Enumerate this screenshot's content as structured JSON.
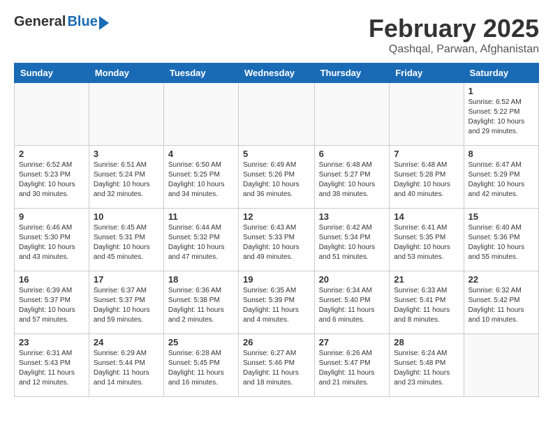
{
  "header": {
    "logo_general": "General",
    "logo_blue": "Blue",
    "month": "February 2025",
    "location": "Qashqal, Parwan, Afghanistan"
  },
  "weekdays": [
    "Sunday",
    "Monday",
    "Tuesday",
    "Wednesday",
    "Thursday",
    "Friday",
    "Saturday"
  ],
  "weeks": [
    [
      {
        "day": "",
        "info": ""
      },
      {
        "day": "",
        "info": ""
      },
      {
        "day": "",
        "info": ""
      },
      {
        "day": "",
        "info": ""
      },
      {
        "day": "",
        "info": ""
      },
      {
        "day": "",
        "info": ""
      },
      {
        "day": "1",
        "info": "Sunrise: 6:52 AM\nSunset: 5:22 PM\nDaylight: 10 hours and 29 minutes."
      }
    ],
    [
      {
        "day": "2",
        "info": "Sunrise: 6:52 AM\nSunset: 5:23 PM\nDaylight: 10 hours and 30 minutes."
      },
      {
        "day": "3",
        "info": "Sunrise: 6:51 AM\nSunset: 5:24 PM\nDaylight: 10 hours and 32 minutes."
      },
      {
        "day": "4",
        "info": "Sunrise: 6:50 AM\nSunset: 5:25 PM\nDaylight: 10 hours and 34 minutes."
      },
      {
        "day": "5",
        "info": "Sunrise: 6:49 AM\nSunset: 5:26 PM\nDaylight: 10 hours and 36 minutes."
      },
      {
        "day": "6",
        "info": "Sunrise: 6:48 AM\nSunset: 5:27 PM\nDaylight: 10 hours and 38 minutes."
      },
      {
        "day": "7",
        "info": "Sunrise: 6:48 AM\nSunset: 5:28 PM\nDaylight: 10 hours and 40 minutes."
      },
      {
        "day": "8",
        "info": "Sunrise: 6:47 AM\nSunset: 5:29 PM\nDaylight: 10 hours and 42 minutes."
      }
    ],
    [
      {
        "day": "9",
        "info": "Sunrise: 6:46 AM\nSunset: 5:30 PM\nDaylight: 10 hours and 43 minutes."
      },
      {
        "day": "10",
        "info": "Sunrise: 6:45 AM\nSunset: 5:31 PM\nDaylight: 10 hours and 45 minutes."
      },
      {
        "day": "11",
        "info": "Sunrise: 6:44 AM\nSunset: 5:32 PM\nDaylight: 10 hours and 47 minutes."
      },
      {
        "day": "12",
        "info": "Sunrise: 6:43 AM\nSunset: 5:33 PM\nDaylight: 10 hours and 49 minutes."
      },
      {
        "day": "13",
        "info": "Sunrise: 6:42 AM\nSunset: 5:34 PM\nDaylight: 10 hours and 51 minutes."
      },
      {
        "day": "14",
        "info": "Sunrise: 6:41 AM\nSunset: 5:35 PM\nDaylight: 10 hours and 53 minutes."
      },
      {
        "day": "15",
        "info": "Sunrise: 6:40 AM\nSunset: 5:36 PM\nDaylight: 10 hours and 55 minutes."
      }
    ],
    [
      {
        "day": "16",
        "info": "Sunrise: 6:39 AM\nSunset: 5:37 PM\nDaylight: 10 hours and 57 minutes."
      },
      {
        "day": "17",
        "info": "Sunrise: 6:37 AM\nSunset: 5:37 PM\nDaylight: 10 hours and 59 minutes."
      },
      {
        "day": "18",
        "info": "Sunrise: 6:36 AM\nSunset: 5:38 PM\nDaylight: 11 hours and 2 minutes."
      },
      {
        "day": "19",
        "info": "Sunrise: 6:35 AM\nSunset: 5:39 PM\nDaylight: 11 hours and 4 minutes."
      },
      {
        "day": "20",
        "info": "Sunrise: 6:34 AM\nSunset: 5:40 PM\nDaylight: 11 hours and 6 minutes."
      },
      {
        "day": "21",
        "info": "Sunrise: 6:33 AM\nSunset: 5:41 PM\nDaylight: 11 hours and 8 minutes."
      },
      {
        "day": "22",
        "info": "Sunrise: 6:32 AM\nSunset: 5:42 PM\nDaylight: 11 hours and 10 minutes."
      }
    ],
    [
      {
        "day": "23",
        "info": "Sunrise: 6:31 AM\nSunset: 5:43 PM\nDaylight: 11 hours and 12 minutes."
      },
      {
        "day": "24",
        "info": "Sunrise: 6:29 AM\nSunset: 5:44 PM\nDaylight: 11 hours and 14 minutes."
      },
      {
        "day": "25",
        "info": "Sunrise: 6:28 AM\nSunset: 5:45 PM\nDaylight: 11 hours and 16 minutes."
      },
      {
        "day": "26",
        "info": "Sunrise: 6:27 AM\nSunset: 5:46 PM\nDaylight: 11 hours and 18 minutes."
      },
      {
        "day": "27",
        "info": "Sunrise: 6:26 AM\nSunset: 5:47 PM\nDaylight: 11 hours and 21 minutes."
      },
      {
        "day": "28",
        "info": "Sunrise: 6:24 AM\nSunset: 5:48 PM\nDaylight: 11 hours and 23 minutes."
      },
      {
        "day": "",
        "info": ""
      }
    ]
  ]
}
